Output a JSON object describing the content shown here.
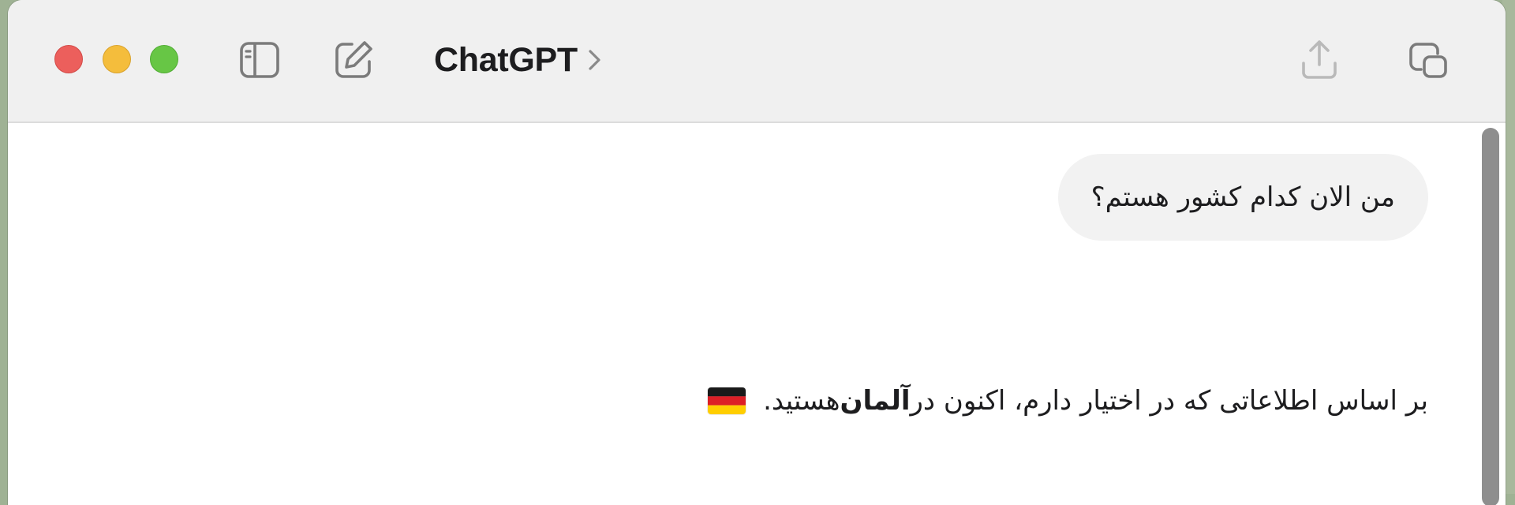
{
  "window": {
    "title": "ChatGPT"
  },
  "toolbar": {
    "icons": [
      "sidebar-icon",
      "compose-icon",
      "chevron-right-icon",
      "share-icon",
      "new-window-icon"
    ]
  },
  "conversation": {
    "user_message": "من الان کدام کشور هستم؟",
    "assistant_message": {
      "text_before": "بر اساس اطلاعاتی که در اختیار دارم، اکنون در ",
      "bold": "آلمان",
      "text_after": " هستید.",
      "emoji": "🇩🇪",
      "emoji_icon": "germany-flag-icon"
    }
  },
  "colors": {
    "close": "#ec5f5c",
    "minimize": "#f4bd3c",
    "maximize": "#67c645",
    "titlebar": "#f0f0f0",
    "bubble": "#f2f2f2"
  }
}
